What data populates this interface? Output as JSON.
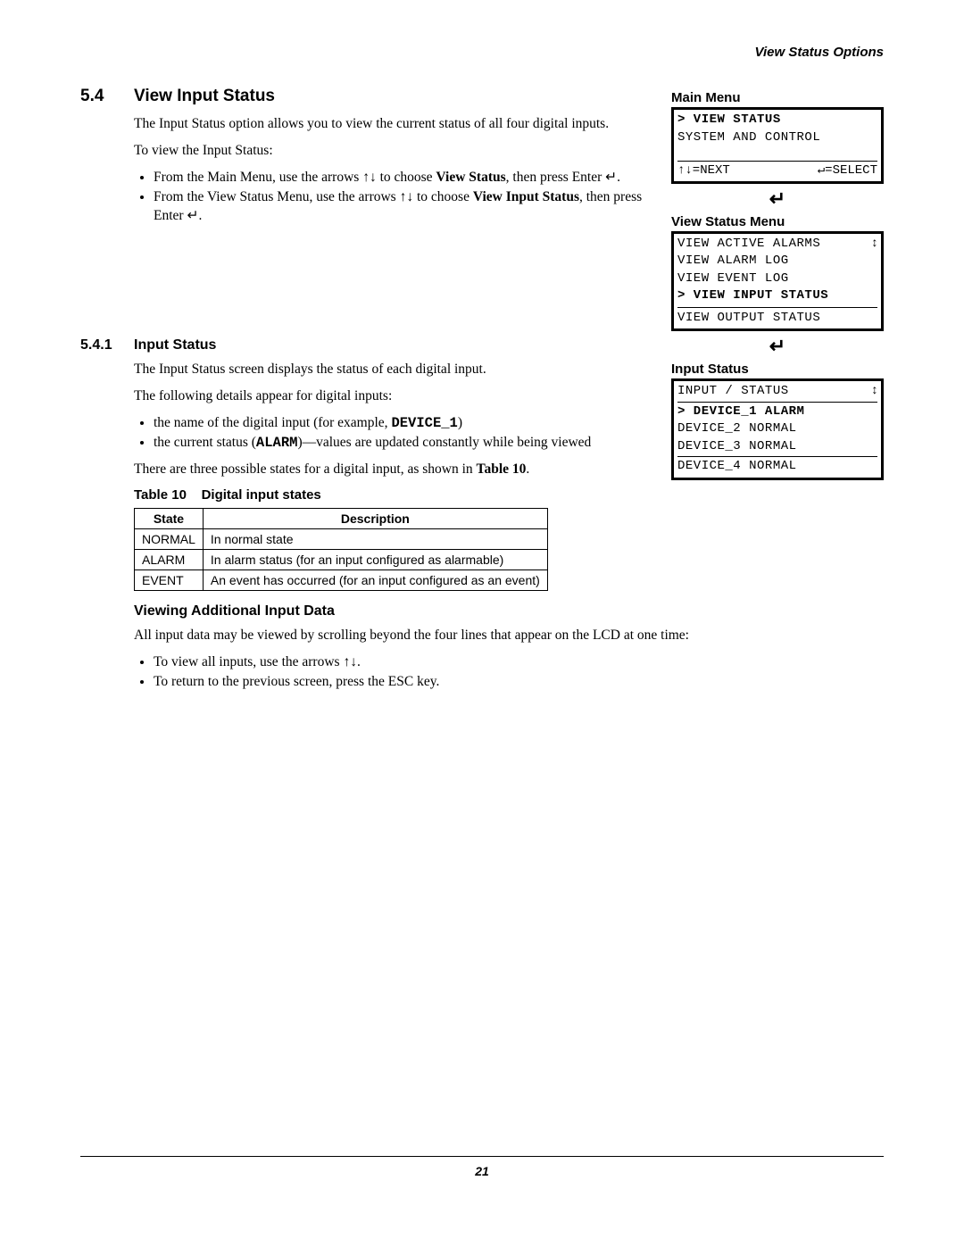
{
  "header": {
    "breadcrumb": "View Status Options"
  },
  "section": {
    "num": "5.4",
    "title": "View Input Status",
    "p1": "The Input Status option allows you to view the current status of all four digital inputs.",
    "p2": "To view the Input Status:",
    "b1a": "From the Main Menu, use the arrows ",
    "b1b": " to choose ",
    "b1c": "View Status",
    "b1d": ", then press Enter ",
    "b1e": ".",
    "b2a": "From the View Status Menu, use the arrows ",
    "b2b": " to choose ",
    "b2c": "View Input Status",
    "b2d": ", then press Enter ",
    "b2e": "."
  },
  "subsection": {
    "num": "5.4.1",
    "title": "Input Status",
    "p1": "The Input Status screen displays the status of each digital input.",
    "p2": "The following details appear for digital inputs:",
    "b1a": "the name of the digital input (for example, ",
    "b1_device": "DEVICE_1",
    "b1b": ")",
    "b2a": "the current status (",
    "b2_alarm": "ALARM",
    "b2b": ")—values are updated constantly while being viewed",
    "p3a": "There are three possible states for a digital input, as shown in ",
    "p3_tbl": "Table 10",
    "p3b": "."
  },
  "table": {
    "caption_a": "Table 10",
    "caption_b": "Digital input states",
    "head": {
      "c1": "State",
      "c2": "Description"
    },
    "rows": [
      {
        "c1": "NORMAL",
        "c2": "In normal state"
      },
      {
        "c1": "ALARM",
        "c2": "In alarm status (for an input configured as alarmable)"
      },
      {
        "c1": "EVENT",
        "c2": "An event has occurred (for an input configured as an event)"
      }
    ]
  },
  "viewing": {
    "title": "Viewing Additional Input Data",
    "p1": "All input data may be viewed by scrolling beyond the four lines that appear on the LCD at one time:",
    "b1a": "To view all inputs, use the arrows ",
    "b1b": ".",
    "b2": "To return to the previous screen, press the ESC key."
  },
  "glyphs": {
    "arrows": "↑↓",
    "enter": "↵",
    "enter_big": "↵",
    "updown": "↕"
  },
  "panels": {
    "main": {
      "label": "Main Menu",
      "r1_sel": "> VIEW STATUS",
      "r2": "  SYSTEM AND CONTROL",
      "foot_l": "↑↓=NEXT",
      "foot_r": "↵=SELECT"
    },
    "viewstatus": {
      "label": "View Status Menu",
      "r1": "  VIEW ACTIVE ALARMS",
      "r2": "  VIEW ALARM LOG",
      "r3": "  VIEW EVENT LOG",
      "r4_sel": "> VIEW INPUT STATUS",
      "r5": "  VIEW OUTPUT STATUS",
      "scroll": "↕"
    },
    "inputstatus": {
      "label": "Input Status",
      "head": "  INPUT  /  STATUS",
      "r1_sel": "> DEVICE_1 ALARM",
      "r2": "  DEVICE_2 NORMAL",
      "r3": "  DEVICE_3 NORMAL",
      "r4": "  DEVICE_4 NORMAL",
      "scroll": "↕"
    }
  },
  "footer": {
    "page": "21"
  }
}
